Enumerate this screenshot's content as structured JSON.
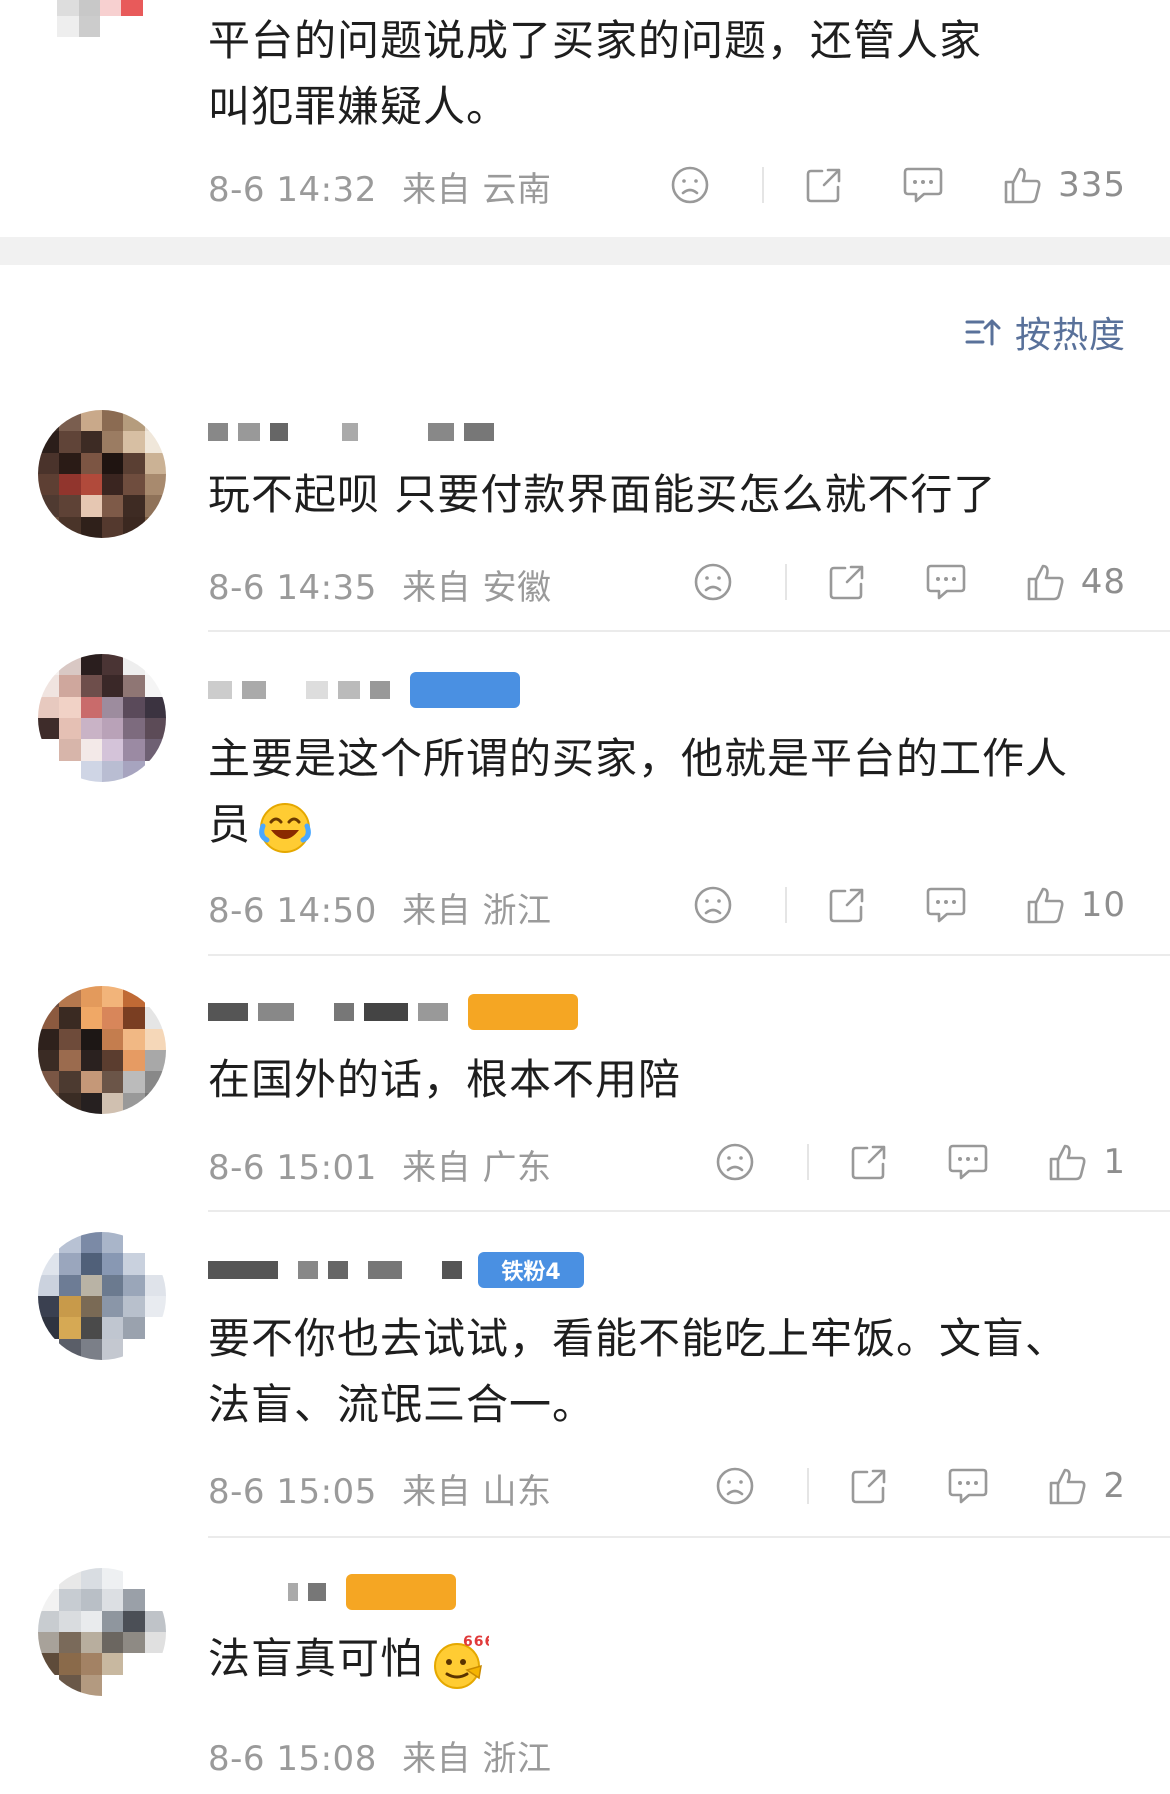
{
  "sort": {
    "label": "按热度"
  },
  "colors": {
    "link_blue": "#59719a",
    "meta_gray": "#9a9a9a",
    "badge_blue": "#4a90e2",
    "badge_orange": "#f5a623"
  },
  "comments": [
    {
      "text": "平台的问题说成了买家的问题，还管人家叫犯罪嫌疑人。",
      "time": "8-6 14:32",
      "from": "来自 云南",
      "likes": "335"
    },
    {
      "text": "玩不起呗  只要付款界面能买怎么就不行了",
      "time": "8-6 14:35",
      "from": "来自 安徽",
      "likes": "48"
    },
    {
      "text": "主要是这个所谓的买家，他就是平台的工作人员",
      "time": "8-6 14:50",
      "from": "来自 浙江",
      "likes": "10"
    },
    {
      "text": "在国外的话，根本不用陪",
      "time": "8-6 15:01",
      "from": "来自 广东",
      "likes": "1"
    },
    {
      "text": "要不你也去试试，看能不能吃上牢饭。文盲、法盲、流氓三合一。",
      "time": "8-6 15:05",
      "from": "来自 山东",
      "likes": "2",
      "badge": "铁粉4"
    },
    {
      "text": "法盲真可怕",
      "time": "8-6 15:08",
      "from": "来自 浙江"
    }
  ],
  "icons": [
    "sad-face-icon",
    "share-icon",
    "comment-icon",
    "thumbs-up-icon",
    "sort-icon"
  ]
}
